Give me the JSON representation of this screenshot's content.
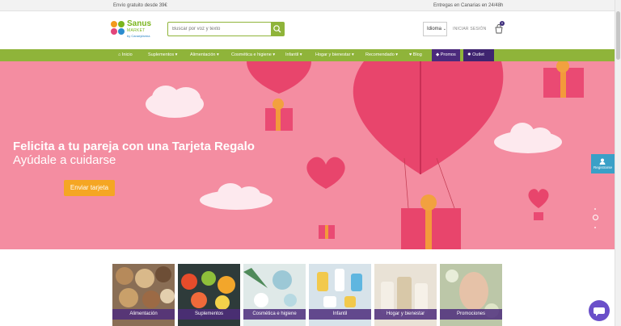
{
  "topbar": {
    "shipping": "Envío gratuito desde 39€",
    "delivery": "Entregas en Canarias en 24/48h"
  },
  "header": {
    "logo_name": "Sanus",
    "logo_market": "MARKET",
    "logo_by": "by Canaryfarma",
    "search_placeholder": "Buscar por voz y texto",
    "language": "Idioma",
    "login": "INICIAR SESIÓN",
    "cart_count": "0"
  },
  "nav": {
    "items": [
      {
        "label": "Inicio",
        "icon": "home-icon"
      },
      {
        "label": "Suplementos ▾"
      },
      {
        "label": "Alimentación ▾"
      },
      {
        "label": "Cosmética e higiene ▾"
      },
      {
        "label": "Infantil ▾"
      },
      {
        "label": "Hogar y bienestar ▾"
      },
      {
        "label": "Recomendado ▾"
      },
      {
        "label": "Blog",
        "icon": "heart-icon"
      },
      {
        "label": "Promos",
        "icon": "tag-icon"
      },
      {
        "label": "Outlet",
        "icon": "percent-icon"
      }
    ]
  },
  "hero": {
    "title": "Felicita a tu pareja con una Tarjeta Regalo",
    "subtitle": "Ayúdale a cuidarse",
    "button": "Enviar tarjeta"
  },
  "sidebar": {
    "register": "Registrarse"
  },
  "categories": [
    {
      "label": "Alimentación"
    },
    {
      "label": "Suplementos"
    },
    {
      "label": "Cosmética e higiene"
    },
    {
      "label": "Infantil"
    },
    {
      "label": "Hogar y bienestar"
    },
    {
      "label": "Promociones"
    }
  ],
  "colors": {
    "brand_green": "#8fb43a",
    "brand_purple": "#4b2a7c",
    "hero_pink": "#f48da1",
    "cta_orange": "#f5a623"
  }
}
